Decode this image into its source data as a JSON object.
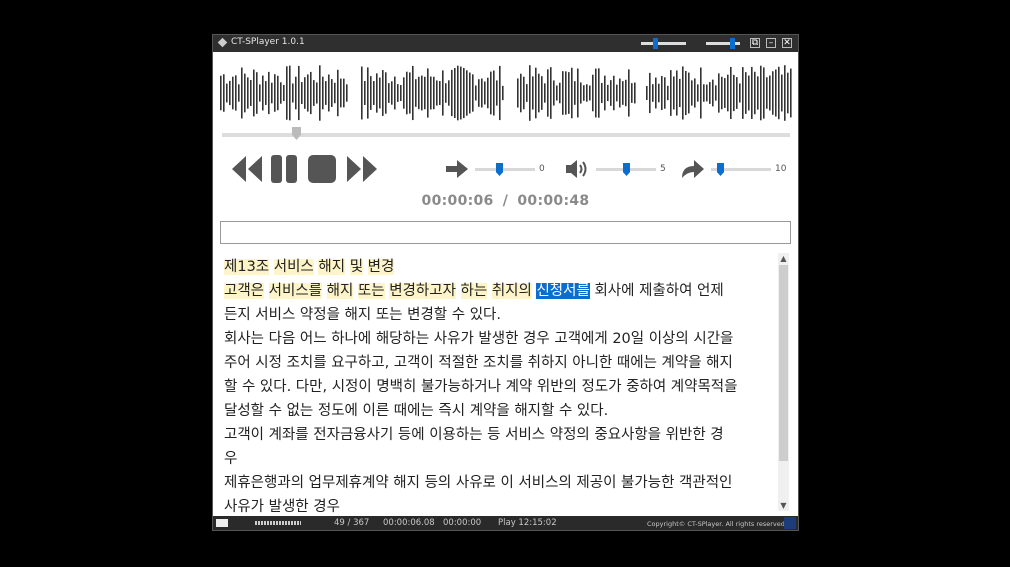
{
  "window": {
    "title": "CT-SPlayer 1.0.1",
    "top_sliders": [
      {
        "name": "speed-mini-slider",
        "level": 0.35
      },
      {
        "name": "volume-mini-slider",
        "level": 0.85
      }
    ],
    "buttons": [
      "restore",
      "minimize",
      "close"
    ]
  },
  "waveform": {
    "color": "#333333"
  },
  "seek": {
    "position": 0.13
  },
  "controls": {
    "rewind": "rewind-icon",
    "pause": "pause-icon",
    "stop": "stop-icon",
    "forward": "fast-forward-icon"
  },
  "adjust": {
    "speed": {
      "icon": "arrow-right-icon",
      "value": "0"
    },
    "volume": {
      "icon": "speaker-icon",
      "value": "5"
    },
    "skip": {
      "icon": "redo-arrow-icon",
      "value": "10"
    }
  },
  "time": {
    "current": "00:00:06",
    "separator": "/",
    "total": "00:00:48"
  },
  "input": {
    "value": ""
  },
  "text": {
    "line1": {
      "a": "제13조",
      "b": "서비스",
      "c": "해지",
      "d": "및",
      "e": "변경"
    },
    "line2": {
      "a": "고객은",
      "b": "서비스를",
      "c": "해지",
      "d": "또는",
      "e": "변경하고자",
      "f": "하는",
      "g": "취지의",
      "h": "신청서를",
      "rest": " 회사에 제출하여 언제"
    },
    "line3": "든지 서비스 약정을 해지 또는 변경할 수 있다.",
    "line4": "회사는 다음 어느 하나에 해당하는 사유가 발생한 경우 고객에게 20일 이상의 시간을",
    "line5": "주어 시정 조치를 요구하고, 고객이 적절한 조치를 취하지 아니한 때에는 계약을 해지",
    "line6": "할 수 있다. 다만, 시정이 명백히 불가능하거나 계약 위반의 정도가 중하여 계약목적을",
    "line7": "달성할 수 없는 정도에 이른 때에는 즉시 계약을 해지할 수 있다.",
    "line8": "고객이 계좌를 전자금융사기 등에 이용하는 등 서비스 약정의 중요사항을 위반한 경",
    "line9": "우",
    "line10": "제휴은행과의 업무제휴계약 해지 등의 사유로 이 서비스의 제공이 불가능한 객관적인",
    "line11": "사유가 발생한 경우"
  },
  "status": {
    "position": "49 / 367",
    "time_a": "00:00:06.08",
    "time_b": "00:00:00",
    "play": "Play 12:15:02",
    "copyright": "Copyright© CT-SPlayer. All rights reserved."
  },
  "colors": {
    "accent": "#0a6ed1",
    "highlight": "#fdf5c8",
    "icon": "#555555"
  }
}
